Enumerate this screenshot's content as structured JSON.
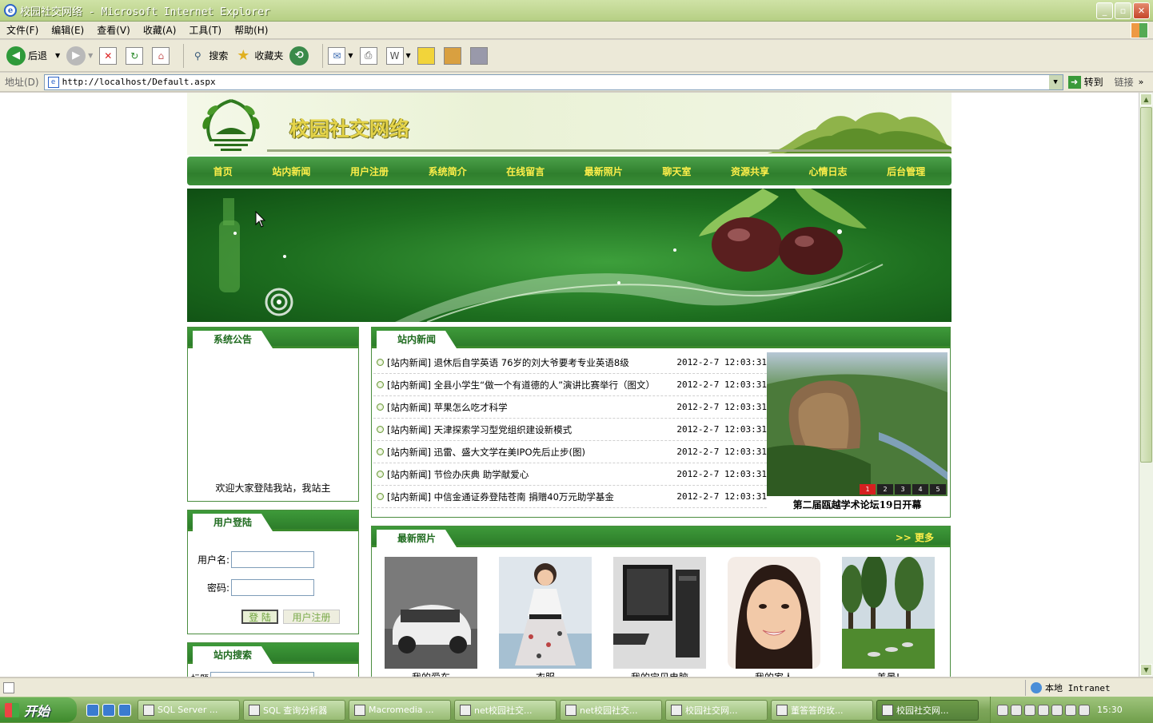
{
  "window": {
    "title": "校园社交网络 - Microsoft Internet Explorer"
  },
  "menu": [
    "文件(F)",
    "编辑(E)",
    "查看(V)",
    "收藏(A)",
    "工具(T)",
    "帮助(H)"
  ],
  "toolbar": {
    "back": "后退",
    "search": "搜索",
    "favorites": "收藏夹"
  },
  "address": {
    "label": "地址(D)",
    "url": "http://localhost/Default.aspx",
    "go": "转到",
    "links": "链接"
  },
  "site": {
    "name": "校园社交网络",
    "nav": [
      "首页",
      "站内新闻",
      "用户注册",
      "系统简介",
      "在线留言",
      "最新照片",
      "聊天室",
      "资源共享",
      "心情日志",
      "后台管理"
    ],
    "notice": {
      "title": "系统公告",
      "text": "欢迎大家登陆我站，我站主"
    },
    "login": {
      "title": "用户登陆",
      "user_label": "用户名:",
      "pass_label": "密码:",
      "login_btn": "登 陆",
      "register_btn": "用户注册"
    },
    "search": {
      "title": "站内搜索",
      "field_label": "标题"
    },
    "news": {
      "title": "站内新闻",
      "items": [
        {
          "text": "[站内新闻] 退休后自学英语 76岁的刘大爷要考专业英语8级",
          "date": "2012-2-7 12:03:31"
        },
        {
          "text": "[站内新闻] 全县小学生“做一个有道德的人”演讲比赛举行（图文）",
          "date": "2012-2-7 12:03:31"
        },
        {
          "text": "[站内新闻] 苹果怎么吃才科学",
          "date": "2012-2-7 12:03:31"
        },
        {
          "text": "[站内新闻] 天津探索学习型党组织建设新模式",
          "date": "2012-2-7 12:03:31"
        },
        {
          "text": "[站内新闻] 迅雷、盛大文学在美IPO先后止步(图)",
          "date": "2012-2-7 12:03:31"
        },
        {
          "text": "[站内新闻] 节俭办庆典 助学献爱心",
          "date": "2012-2-7 12:03:31"
        },
        {
          "text": "[站内新闻] 中信金通证券登陆苍南 捐赠40万元助学基金",
          "date": "2012-2-7 12:03:31"
        }
      ],
      "slide_caption": "第二届瓯越学术论坛19日开幕",
      "slide_pages": [
        "1",
        "2",
        "3",
        "4",
        "5"
      ]
    },
    "photos": {
      "title": "最新照片",
      "more": ">> 更多",
      "items": [
        "我的爱车",
        "衣服",
        "我的宝贝电脑",
        "我的家人",
        "美景!"
      ]
    }
  },
  "status": {
    "zone": "本地 Intranet"
  },
  "taskbar": {
    "start": "开始",
    "tasks": [
      "SQL Server ...",
      "SQL 查询分析器",
      "Macromedia ...",
      "net校园社交...",
      "net校园社交...",
      "校园社交网...",
      "董答答的玫...",
      "校园社交网..."
    ],
    "clock": "15:30"
  }
}
